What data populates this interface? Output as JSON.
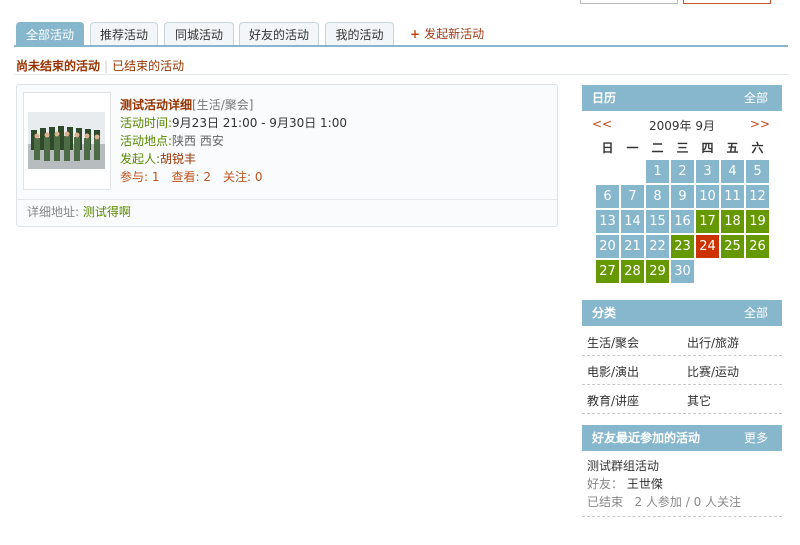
{
  "tabs": [
    {
      "label": "全部活动",
      "active": true
    },
    {
      "label": "推荐活动"
    },
    {
      "label": "同城活动"
    },
    {
      "label": "好友的活动"
    },
    {
      "label": "我的活动"
    }
  ],
  "new_activity": "发起新活动",
  "subnav": {
    "current": "尚未结束的活动",
    "other": "已结束的活动"
  },
  "activity": {
    "title": "测试活动详细",
    "category": "[生活/聚会]",
    "time_label": "活动时间:",
    "time_value": "9月23日 21:00 - 9月30日 1:00",
    "place_label": "活动地点:",
    "place_value": "陕西 西安",
    "organizer_label": "发起人:",
    "organizer_value": "胡锐丰",
    "join_label": "参与: 1",
    "view_label": "查看: 2",
    "follow_label": "关注: 0",
    "detail_label": "详细地址:",
    "detail_value": "测试得啊"
  },
  "calendar": {
    "title": "日历",
    "all": "全部",
    "prev": "<<",
    "next": ">>",
    "month": "2009年 9月",
    "weekdays": [
      "日",
      "一",
      "二",
      "三",
      "四",
      "五",
      "六"
    ],
    "days": [
      {
        "d": "1",
        "s": "n"
      },
      {
        "d": "2",
        "s": "n"
      },
      {
        "d": "3",
        "s": "n"
      },
      {
        "d": "4",
        "s": "n"
      },
      {
        "d": "5",
        "s": "n"
      },
      {
        "d": "6",
        "s": "n"
      },
      {
        "d": "7",
        "s": "n"
      },
      {
        "d": "8",
        "s": "n"
      },
      {
        "d": "9",
        "s": "n"
      },
      {
        "d": "10",
        "s": "n"
      },
      {
        "d": "11",
        "s": "n"
      },
      {
        "d": "12",
        "s": "n"
      },
      {
        "d": "13",
        "s": "n"
      },
      {
        "d": "14",
        "s": "n"
      },
      {
        "d": "15",
        "s": "n"
      },
      {
        "d": "16",
        "s": "n"
      },
      {
        "d": "17",
        "s": "g"
      },
      {
        "d": "18",
        "s": "g"
      },
      {
        "d": "19",
        "s": "g"
      },
      {
        "d": "20",
        "s": "n"
      },
      {
        "d": "21",
        "s": "n"
      },
      {
        "d": "22",
        "s": "n"
      },
      {
        "d": "23",
        "s": "g"
      },
      {
        "d": "24",
        "s": "t"
      },
      {
        "d": "25",
        "s": "g"
      },
      {
        "d": "26",
        "s": "g"
      },
      {
        "d": "27",
        "s": "g"
      },
      {
        "d": "28",
        "s": "g"
      },
      {
        "d": "29",
        "s": "g"
      },
      {
        "d": "30",
        "s": "n"
      }
    ],
    "first_weekday": 2
  },
  "categories": {
    "title": "分类",
    "all": "全部",
    "items": [
      "生活/聚会",
      "出行/旅游",
      "电影/演出",
      "比赛/运动",
      "教育/讲座",
      "其它"
    ]
  },
  "friends": {
    "title": "好友最近参加的活动",
    "more": "更多",
    "activity": "测试群组活动",
    "friend_label": "好友：",
    "friend_name": "王世傑",
    "status": "已结束",
    "counts": "2 人参加 / 0 人关注"
  },
  "colors": {
    "accent": "#87b7cd",
    "link": "#993300",
    "green": "#669900",
    "today": "#cc3300"
  }
}
